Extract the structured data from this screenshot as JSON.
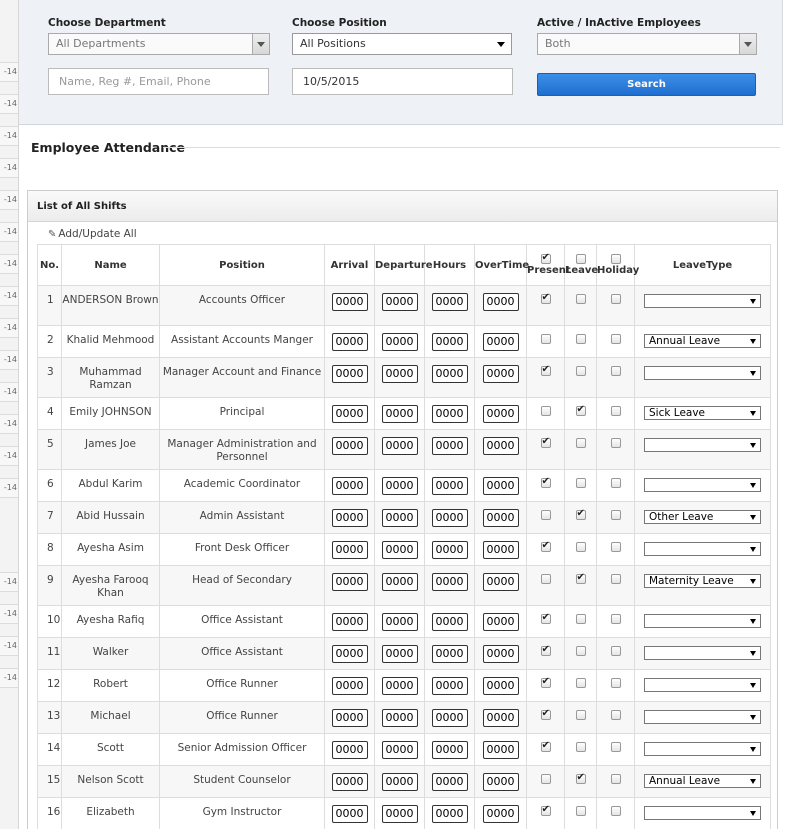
{
  "filters": {
    "department": {
      "label": "Choose Department",
      "value": "All Departments"
    },
    "position": {
      "label": "Choose Position",
      "value": "All Positions"
    },
    "active": {
      "label": "Active / InActive Employees",
      "value": "Both"
    },
    "search_placeholder": "Name, Reg #, Email, Phone",
    "date_value": "10/5/2015",
    "search_button": "Search"
  },
  "section_title": "Employee Attendance",
  "shifts": {
    "title": "List of All Shifts",
    "add_update": "Add/Update All",
    "columns": {
      "no": "No.",
      "name": "Name",
      "position": "Position",
      "arrival": "Arrival",
      "departure": "Departure",
      "hours": "Hours",
      "overtime": "OverTime",
      "present": "Present",
      "leave": "Leave",
      "holiday": "Holiday",
      "leavetype": "LeaveType"
    },
    "rows": [
      {
        "no": "1",
        "name": "ANDERSON Brown",
        "position": "Accounts Officer",
        "arrival": "0000",
        "departure": "0000",
        "hours": "0000",
        "overtime": "0000",
        "present": true,
        "leave": false,
        "holiday": false,
        "leavetype": ""
      },
      {
        "no": "2",
        "name": "Khalid Mehmood",
        "position": "Assistant Accounts Manger",
        "arrival": "0000",
        "departure": "0000",
        "hours": "0000",
        "overtime": "0000",
        "present": false,
        "leave": false,
        "holiday": false,
        "leavetype": "Annual Leave"
      },
      {
        "no": "3",
        "name": "Muhammad Ramzan",
        "position": "Manager Account and Finance",
        "arrival": "0000",
        "departure": "0000",
        "hours": "0000",
        "overtime": "0000",
        "present": true,
        "leave": false,
        "holiday": false,
        "leavetype": ""
      },
      {
        "no": "4",
        "name": "Emily JOHNSON",
        "position": "Principal",
        "arrival": "0000",
        "departure": "0000",
        "hours": "0000",
        "overtime": "0000",
        "present": false,
        "leave": true,
        "holiday": false,
        "leavetype": "Sick Leave"
      },
      {
        "no": "5",
        "name": "James Joe",
        "position": "Manager Administration and Personnel",
        "arrival": "0000",
        "departure": "0000",
        "hours": "0000",
        "overtime": "0000",
        "present": true,
        "leave": false,
        "holiday": false,
        "leavetype": ""
      },
      {
        "no": "6",
        "name": "Abdul Karim",
        "position": "Academic Coordinator",
        "arrival": "0000",
        "departure": "0000",
        "hours": "0000",
        "overtime": "0000",
        "present": true,
        "leave": false,
        "holiday": false,
        "leavetype": ""
      },
      {
        "no": "7",
        "name": "Abid Hussain",
        "position": "Admin Assistant",
        "arrival": "0000",
        "departure": "0000",
        "hours": "0000",
        "overtime": "0000",
        "present": false,
        "leave": true,
        "holiday": false,
        "leavetype": "Other Leave"
      },
      {
        "no": "8",
        "name": "Ayesha Asim",
        "position": "Front Desk Officer",
        "arrival": "0000",
        "departure": "0000",
        "hours": "0000",
        "overtime": "0000",
        "present": true,
        "leave": false,
        "holiday": false,
        "leavetype": ""
      },
      {
        "no": "9",
        "name": "Ayesha Farooq Khan",
        "position": "Head of Secondary",
        "arrival": "0000",
        "departure": "0000",
        "hours": "0000",
        "overtime": "0000",
        "present": false,
        "leave": true,
        "holiday": false,
        "leavetype": "Maternity Leave"
      },
      {
        "no": "10",
        "name": "Ayesha Rafiq",
        "position": "Office Assistant",
        "arrival": "0000",
        "departure": "0000",
        "hours": "0000",
        "overtime": "0000",
        "present": true,
        "leave": false,
        "holiday": false,
        "leavetype": ""
      },
      {
        "no": "11",
        "name": "Walker",
        "position": "Office Assistant",
        "arrival": "0000",
        "departure": "0000",
        "hours": "0000",
        "overtime": "0000",
        "present": true,
        "leave": false,
        "holiday": false,
        "leavetype": ""
      },
      {
        "no": "12",
        "name": "Robert",
        "position": "Office Runner",
        "arrival": "0000",
        "departure": "0000",
        "hours": "0000",
        "overtime": "0000",
        "present": true,
        "leave": false,
        "holiday": false,
        "leavetype": ""
      },
      {
        "no": "13",
        "name": "Michael",
        "position": "Office Runner",
        "arrival": "0000",
        "departure": "0000",
        "hours": "0000",
        "overtime": "0000",
        "present": true,
        "leave": false,
        "holiday": false,
        "leavetype": ""
      },
      {
        "no": "14",
        "name": "Scott",
        "position": "Senior Admission Officer",
        "arrival": "0000",
        "departure": "0000",
        "hours": "0000",
        "overtime": "0000",
        "present": true,
        "leave": false,
        "holiday": false,
        "leavetype": ""
      },
      {
        "no": "15",
        "name": "Nelson Scott",
        "position": "Student Counselor",
        "arrival": "0000",
        "departure": "0000",
        "hours": "0000",
        "overtime": "0000",
        "present": false,
        "leave": true,
        "holiday": false,
        "leavetype": "Annual Leave"
      },
      {
        "no": "16",
        "name": "Elizabeth",
        "position": "Gym Instructor",
        "arrival": "0000",
        "departure": "0000",
        "hours": "0000",
        "overtime": "0000",
        "present": true,
        "leave": false,
        "holiday": false,
        "leavetype": ""
      }
    ]
  },
  "sidebar": {
    "tick_label": "-14"
  }
}
